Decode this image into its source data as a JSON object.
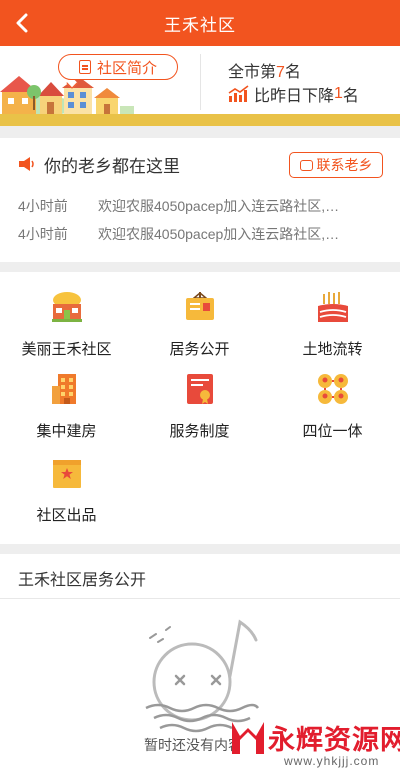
{
  "header": {
    "title": "王禾社区",
    "back_icon": "chevron-left-icon"
  },
  "banner": {
    "intro_label": "社区简介",
    "rank_prefix": "全市第",
    "rank_value": "7",
    "rank_suffix": "名",
    "drop_prefix": "比昨日下降",
    "drop_value": "1",
    "drop_suffix": "名"
  },
  "hometown": {
    "title": "你的老乡都在这里",
    "contact_label": "联系老乡",
    "items": [
      {
        "time": "4小时前",
        "text": "欢迎农服4050pacep加入连云路社区,…"
      },
      {
        "time": "4小时前",
        "text": "欢迎农服4050pacep加入连云路社区,…"
      }
    ]
  },
  "grid": [
    {
      "label": "美丽王禾社区",
      "icon": "village-icon"
    },
    {
      "label": "居务公开",
      "icon": "notice-board-icon"
    },
    {
      "label": "土地流转",
      "icon": "farmland-icon"
    },
    {
      "label": "集中建房",
      "icon": "building-icon"
    },
    {
      "label": "服务制度",
      "icon": "document-seal-icon"
    },
    {
      "label": "四位一体",
      "icon": "four-people-icon"
    },
    {
      "label": "社区出品",
      "icon": "product-box-icon"
    }
  ],
  "affairs": {
    "title": "王禾社区居务公开",
    "empty_text": "暂时还没有内容哦"
  },
  "watermark": {
    "main": "永辉资源网",
    "url": "www.yhkjjj.com"
  },
  "colors": {
    "accent": "#f2541f",
    "ground": "#e9c248",
    "separator": "#eeeeee"
  }
}
